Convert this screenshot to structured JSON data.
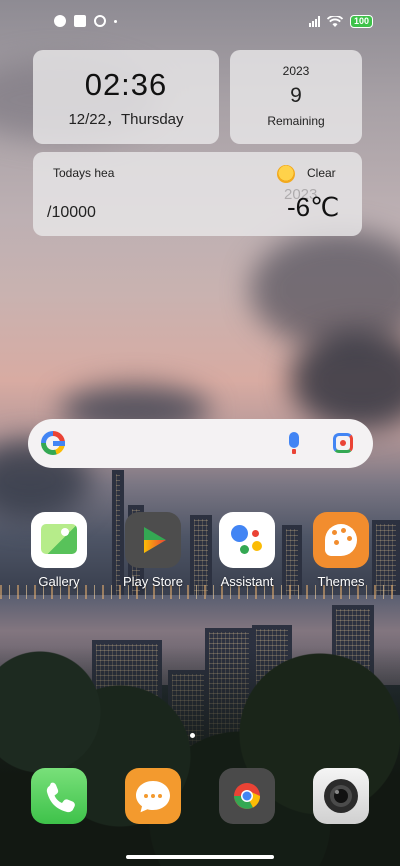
{
  "status_bar": {
    "battery": "100"
  },
  "widgets": {
    "clock": {
      "time": "02:36",
      "date": "12/22，Thursday"
    },
    "year": {
      "year": "2023",
      "count": "9",
      "label": "Remaining"
    },
    "health": {
      "title": "Todays hea",
      "steps": "/10000",
      "weather_condition": "Clear",
      "ghost_text": "2023",
      "temperature": "-6℃"
    }
  },
  "search_bar": {
    "icons": [
      "google-logo-icon",
      "microphone-icon",
      "lens-camera-icon"
    ]
  },
  "apps": [
    {
      "label": "Gallery",
      "icon": "gallery-icon"
    },
    {
      "label": "Play Store",
      "icon": "play-store-icon"
    },
    {
      "label": "Assistant",
      "icon": "assistant-icon"
    },
    {
      "label": "Themes",
      "icon": "themes-icon"
    }
  ],
  "dock": [
    {
      "icon": "phone-icon"
    },
    {
      "icon": "messages-icon"
    },
    {
      "icon": "chrome-icon"
    },
    {
      "icon": "camera-icon"
    }
  ],
  "colors": {
    "battery_fill": "#3ec24a",
    "google_blue": "#4285f4",
    "google_red": "#ea4335",
    "google_yellow": "#fbbc05",
    "google_green": "#34a853"
  }
}
